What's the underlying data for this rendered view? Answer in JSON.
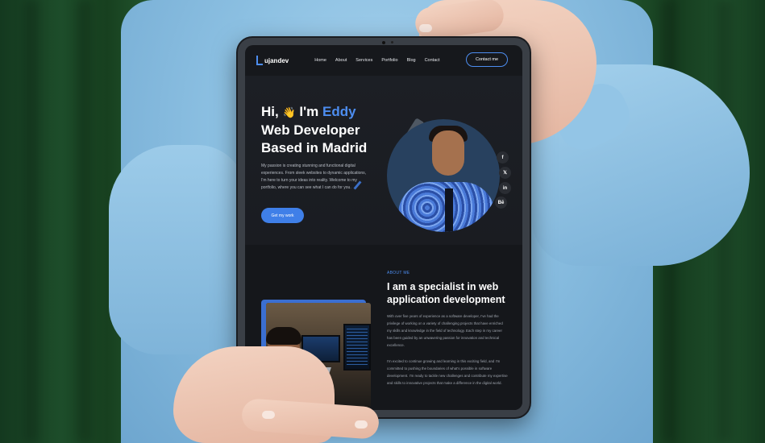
{
  "nav": {
    "logo_text": "ujandev",
    "links": [
      "Home",
      "About",
      "Services",
      "Portfolio",
      "Blog",
      "Contact"
    ],
    "contact_button": "Contact me"
  },
  "hero": {
    "greeting_prefix": "Hi,",
    "wave_emoji": "👋",
    "greeting_mid": " I'm ",
    "name": "Eddy",
    "line2": "Web Developer",
    "line3": "Based in Madrid",
    "description": "My passion is creating stunning and functional digital experiences. From sleek websites to dynamic applications, I'm here to turn your ideas into reality. Welcome to my portfolio, where you can see what I can do for you.",
    "cta_label": "Get my work"
  },
  "social": {
    "facebook": "f",
    "x": "𝕏",
    "linkedin": "in",
    "behance": "Bē"
  },
  "about": {
    "kicker": "ABOUT ME",
    "title": "I am a specialist in web application development",
    "paragraph1": "With over five years of experience as a software developer, I've had the privilege of working on a variety of challenging projects that have enriched my skills and knowledge in the field of technology. Each step in my career has been guided by an unwavering passion for innovation and technical excellence.",
    "paragraph2": "I'm excited to continue growing and learning in this exciting field, and I'm committed to pushing the boundaries of what's possible in software development. I'm ready to tackle new challenges and contribute my expertise and skills to innovative projects that make a difference in the digital world."
  },
  "colors": {
    "accent": "#4d8df0",
    "background": "#16181c",
    "hoodie": "#8cc0e2",
    "curtain": "#1d4d2a"
  }
}
